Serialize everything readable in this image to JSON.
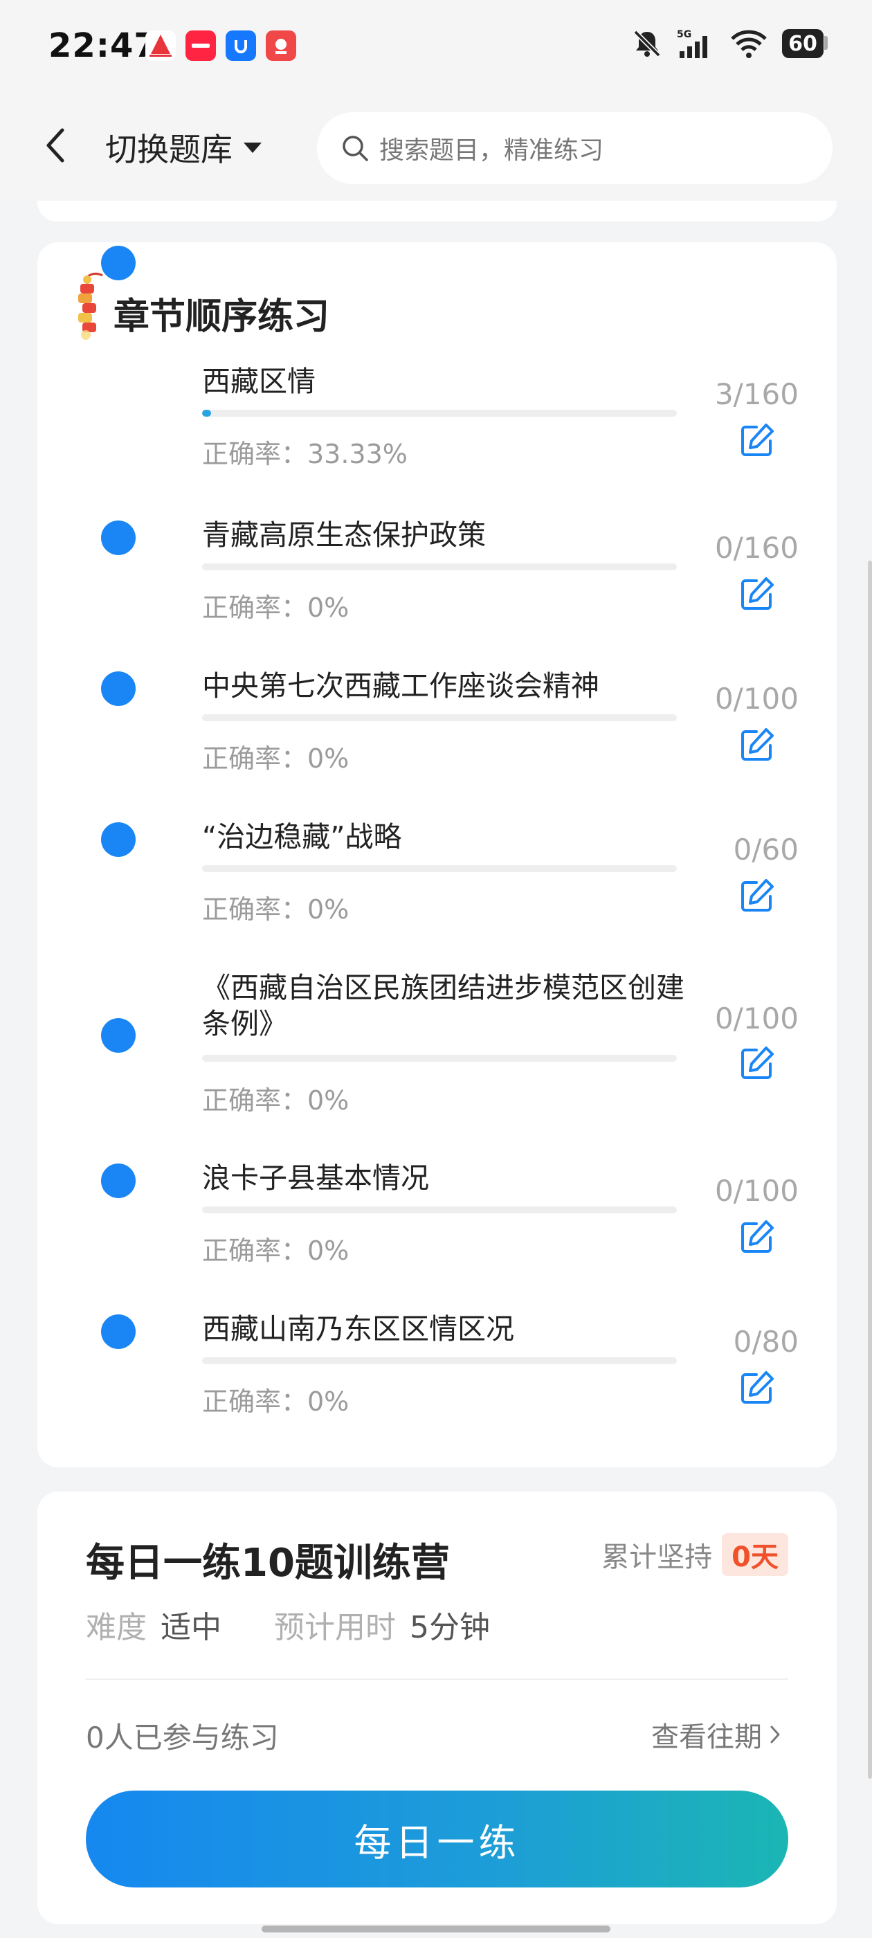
{
  "status_bar": {
    "time": "22:47",
    "battery": "60",
    "network": "5G",
    "icons": [
      "bell-muted-icon",
      "signal-icon",
      "wifi-icon",
      "battery-icon"
    ]
  },
  "header": {
    "switch_label": "切换题库",
    "search_placeholder": "搜索题目，精准练习"
  },
  "chapters": {
    "title": "章节顺序练习",
    "items": [
      {
        "name": "西藏区情",
        "accuracy": "正确率：33.33%",
        "count": "3/160",
        "progress": 0.019
      },
      {
        "name": "青藏高原生态保护政策",
        "accuracy": "正确率：0%",
        "count": "0/160",
        "progress": 0
      },
      {
        "name": "中央第七次西藏工作座谈会精神",
        "accuracy": "正确率：0%",
        "count": "0/100",
        "progress": 0
      },
      {
        "name": "“治边稳藏”战略",
        "accuracy": "正确率：0%",
        "count": "0/60",
        "progress": 0
      },
      {
        "name": "《西藏自治区民族团结进步模范区创建条例》",
        "accuracy": "正确率：0%",
        "count": "0/100",
        "progress": 0
      },
      {
        "name": "浪卡子县基本情况",
        "accuracy": "正确率：0%",
        "count": "0/100",
        "progress": 0
      },
      {
        "name": "西藏山南乃东区区情区况",
        "accuracy": "正确率：0%",
        "count": "0/80",
        "progress": 0
      }
    ]
  },
  "daily": {
    "title": "每日一练10题训练营",
    "streak_label": "累计坚持",
    "streak_value": "0天",
    "difficulty_label": "难度",
    "difficulty_value": "适中",
    "time_label": "预计用时",
    "time_value": "5分钟",
    "participants": "0人已参与练习",
    "history_link": "查看往期",
    "button": "每日一练"
  },
  "colors": {
    "accent": "#1a86f5",
    "streak": "#f0502a"
  }
}
